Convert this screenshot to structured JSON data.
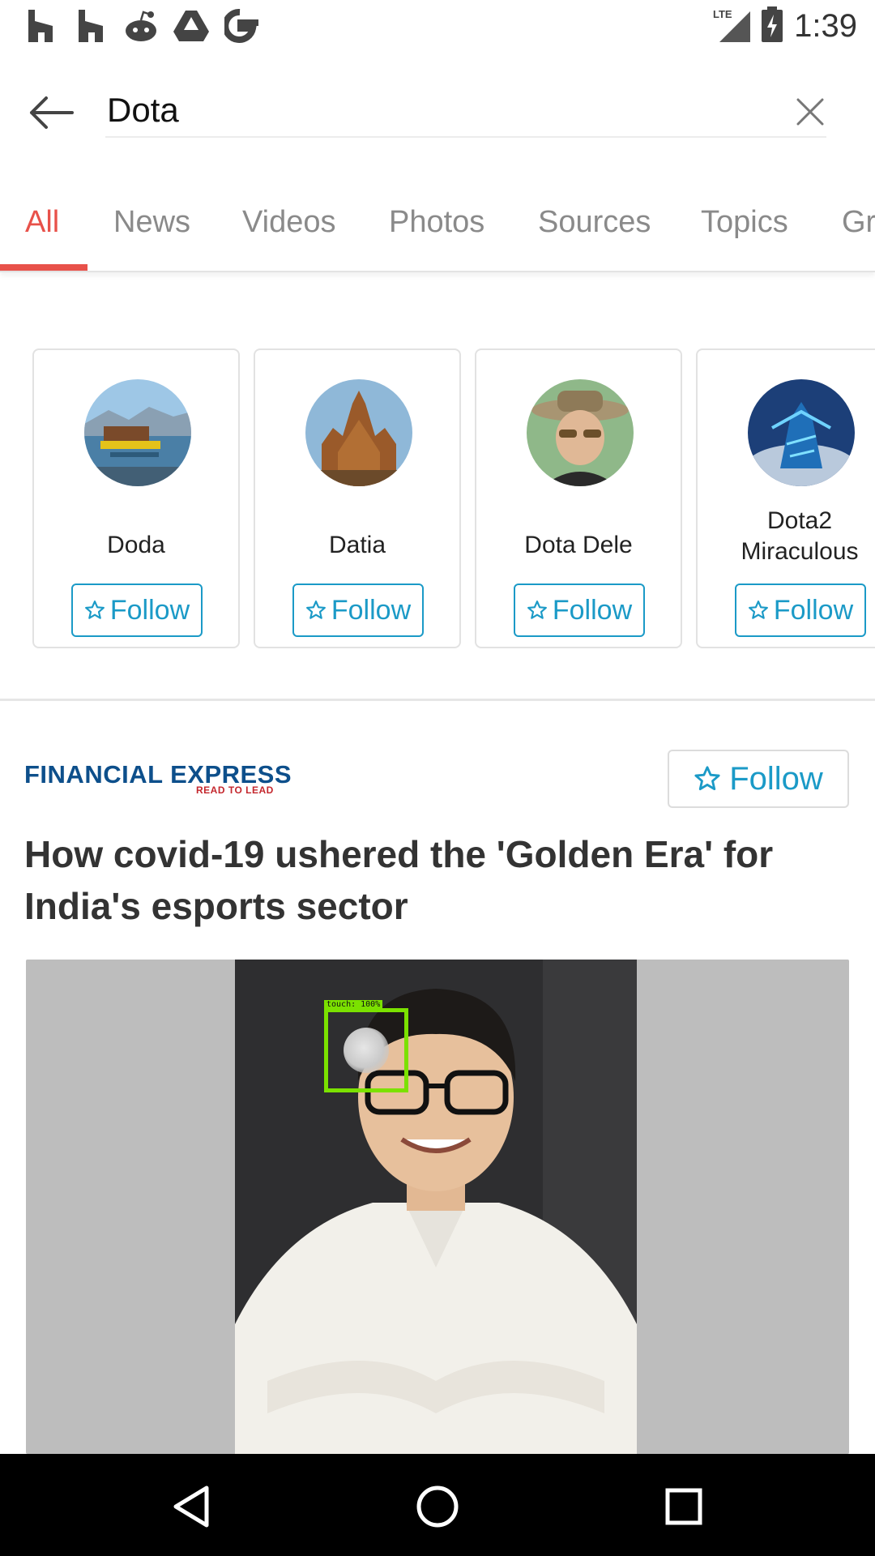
{
  "status_bar": {
    "time": "1:39",
    "network": "LTE",
    "notification_icons": [
      "houzz-icon",
      "houzz-icon",
      "reddit-icon",
      "drive-icon",
      "google-icon"
    ]
  },
  "search": {
    "value": "Dota",
    "placeholder": ""
  },
  "tabs": [
    {
      "label": "All",
      "active": true
    },
    {
      "label": "News",
      "active": false
    },
    {
      "label": "Videos",
      "active": false
    },
    {
      "label": "Photos",
      "active": false
    },
    {
      "label": "Sources",
      "active": false
    },
    {
      "label": "Topics",
      "active": false
    },
    {
      "label": "Gr",
      "active": false
    }
  ],
  "entities": [
    {
      "name": "Doda",
      "follow_label": "Follow"
    },
    {
      "name": "Datia",
      "follow_label": "Follow"
    },
    {
      "name": "Dota Dele",
      "follow_label": "Follow"
    },
    {
      "name": "Dota2\nMiraculous",
      "follow_label": "Follow"
    }
  ],
  "article": {
    "source_name": "FINANCIAL EXPRESS",
    "source_tagline": "READ TO LEAD",
    "follow_label": "Follow",
    "headline": "How covid-19 ushered the 'Golden Era' for India's esports sector"
  },
  "touch_overlay": {
    "label": "touch: 100%"
  },
  "colors": {
    "accent": "#e8514a",
    "follow": "#1b9ac7",
    "logo_blue": "#0d4f8b",
    "logo_red": "#c4272d"
  }
}
